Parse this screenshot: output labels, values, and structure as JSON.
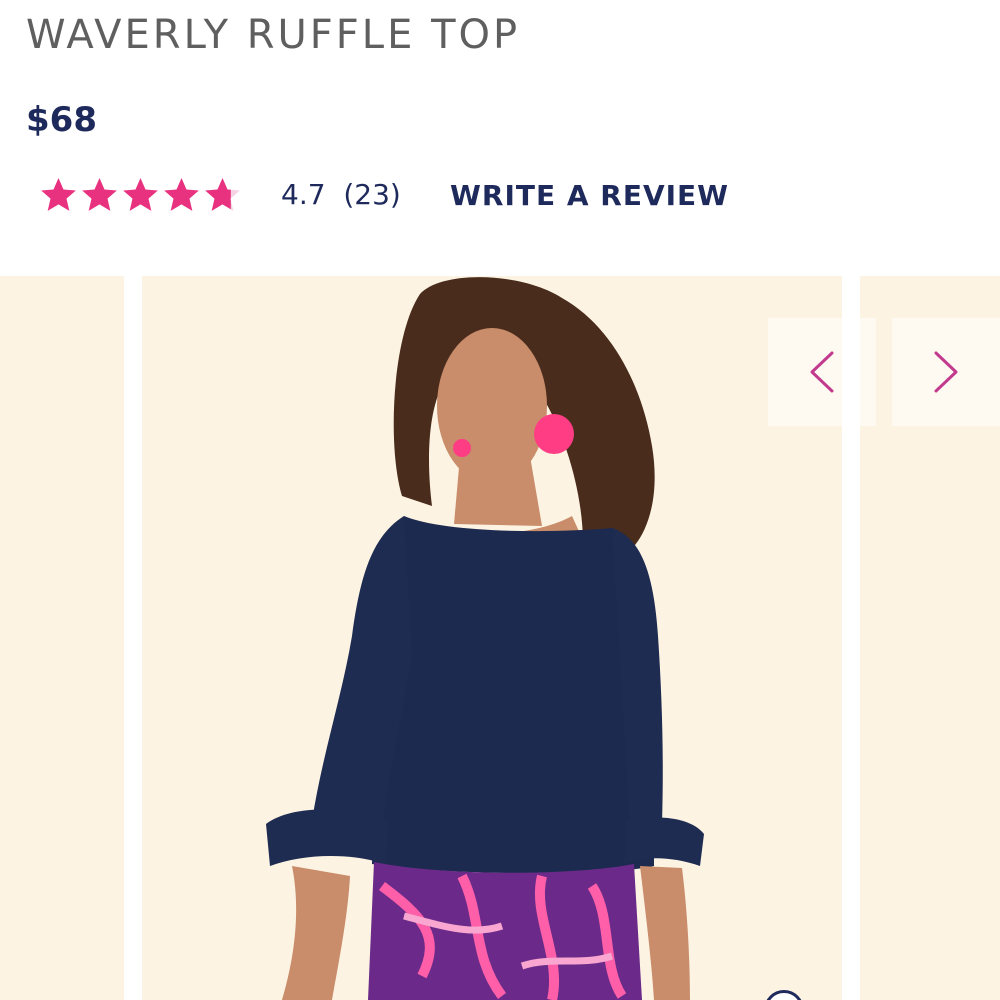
{
  "product": {
    "title": "WAVERLY RUFFLE TOP",
    "price": "$68"
  },
  "rating": {
    "value": 4.7,
    "max_stars": 5,
    "text": "4.7  (23)",
    "write_review_label": "WRITE A REVIEW"
  },
  "colors": {
    "star_pink": "#e8327f",
    "navy": "#1f2a5c",
    "title_gray": "#5f5f5f",
    "slide_background": "#fcf3e2",
    "arrow_pink": "#c23a8e"
  },
  "carousel": {
    "prev_icon": "chevron-left-icon",
    "next_icon": "chevron-right-icon",
    "main_image": "model-in-navy-ruffle-top-photo"
  }
}
